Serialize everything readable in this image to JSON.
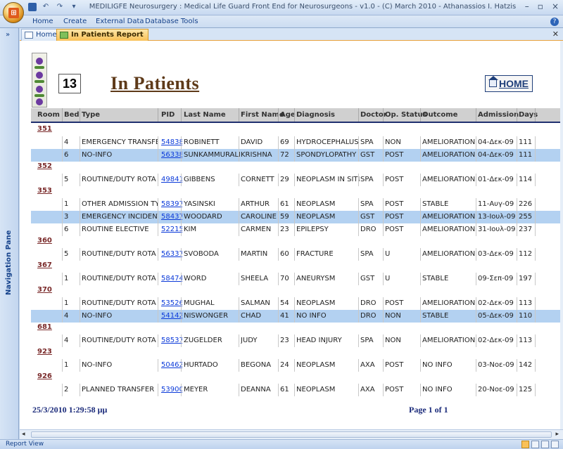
{
  "window": {
    "title": "MEDILIGFE Neurosurgery : Medical Life Guard Front End for Neurosurgeons - v1.0 - (C) March 2010 - Athanassios I. Hatzis",
    "controls": [
      "–",
      "▫",
      "×"
    ]
  },
  "ribbon": {
    "tabs": [
      "Home",
      "Create",
      "External Data",
      "Database Tools"
    ]
  },
  "nav_pane": {
    "label": "Navigation Pane",
    "toggle": "»"
  },
  "doc_tabs": [
    {
      "label": "Home",
      "active": false
    },
    {
      "label": "In Patients Report",
      "active": true
    }
  ],
  "report": {
    "count": "13",
    "title": "In Patients",
    "home_button": "HOME",
    "columns": [
      "Room",
      "Bed",
      "Type",
      "PID",
      "Last Name",
      "First Name",
      "Age",
      "Diagnosis",
      "Doctor",
      "Op. Status",
      "Outcome",
      "Admission",
      "Days"
    ],
    "groups": [
      {
        "room": "351",
        "rows": [
          {
            "bed": "4",
            "type": "EMERGENCY TRANSFER",
            "pid": "54838",
            "last": "ROBINETT",
            "first": "DAVID",
            "age": "69",
            "diagnosis": "HYDROCEPHALUS",
            "doctor": "SPA",
            "op": "NON",
            "outcome": "AMELIORATION",
            "admission": "04-Δεκ-09",
            "days": "111",
            "highlight": false
          },
          {
            "bed": "6",
            "type": "NO-INFO",
            "pid": "56338",
            "last": "SUNKAMMURALI",
            "first": "KRISHNA",
            "age": "72",
            "diagnosis": "SPONDYLOPATHY",
            "doctor": "GST",
            "op": "POST",
            "outcome": "AMELIORATION",
            "admission": "04-Δεκ-09",
            "days": "111",
            "highlight": true
          }
        ]
      },
      {
        "room": "352",
        "rows": [
          {
            "bed": "5",
            "type": "ROUTINE/DUTY ROTA",
            "pid": "49841",
            "last": "GIBBENS",
            "first": "CORNETT",
            "age": "29",
            "diagnosis": "NEOPLASM IN SITU",
            "doctor": "SPA",
            "op": "POST",
            "outcome": "AMELIORATION",
            "admission": "01-Δεκ-09",
            "days": "114",
            "highlight": false
          }
        ]
      },
      {
        "room": "353",
        "rows": [
          {
            "bed": "1",
            "type": "OTHER ADMISSION TYPE",
            "pid": "58397",
            "last": "YASINSKI",
            "first": "ARTHUR",
            "age": "61",
            "diagnosis": "NEOPLASM",
            "doctor": "SPA",
            "op": "POST",
            "outcome": "STABLE",
            "admission": "11-Αυγ-09",
            "days": "226",
            "highlight": false
          },
          {
            "bed": "3",
            "type": "EMERGENCY INCIDENT",
            "pid": "58437",
            "last": "WOODARD",
            "first": "CAROLINE",
            "age": "59",
            "diagnosis": "NEOPLASM",
            "doctor": "GST",
            "op": "POST",
            "outcome": "AMELIORATION",
            "admission": "13-Ιουλ-09",
            "days": "255",
            "highlight": true
          },
          {
            "bed": "6",
            "type": "ROUTINE ELECTIVE",
            "pid": "52215",
            "last": "KIM",
            "first": "CARMEN",
            "age": "23",
            "diagnosis": "EPILEPSY",
            "doctor": "DRO",
            "op": "POST",
            "outcome": "AMELIORATION",
            "admission": "31-Ιουλ-09",
            "days": "237",
            "highlight": false
          }
        ]
      },
      {
        "room": "360",
        "rows": [
          {
            "bed": "5",
            "type": "ROUTINE/DUTY ROTA",
            "pid": "56337",
            "last": "SVOBODA",
            "first": "MARTIN",
            "age": "60",
            "diagnosis": "FRACTURE",
            "doctor": "SPA",
            "op": "U",
            "outcome": "AMELIORATION",
            "admission": "03-Δεκ-09",
            "days": "112",
            "highlight": false
          }
        ]
      },
      {
        "room": "367",
        "rows": [
          {
            "bed": "1",
            "type": "ROUTINE/DUTY ROTA",
            "pid": "58474",
            "last": "WORD",
            "first": "SHEELA",
            "age": "70",
            "diagnosis": "ANEURYSM",
            "doctor": "GST",
            "op": "U",
            "outcome": "STABLE",
            "admission": "09-Σεπ-09",
            "days": "197",
            "highlight": false
          }
        ]
      },
      {
        "room": "370",
        "rows": [
          {
            "bed": "1",
            "type": "ROUTINE/DUTY ROTA",
            "pid": "53526",
            "last": "MUGHAL",
            "first": "SALMAN",
            "age": "54",
            "diagnosis": "NEOPLASM",
            "doctor": "DRO",
            "op": "POST",
            "outcome": "AMELIORATION",
            "admission": "02-Δεκ-09",
            "days": "113",
            "highlight": false
          },
          {
            "bed": "4",
            "type": "NO-INFO",
            "pid": "54142",
            "last": "NISWONGER",
            "first": "CHAD",
            "age": "41",
            "diagnosis": "NO INFO",
            "doctor": "DRO",
            "op": "NON",
            "outcome": "STABLE",
            "admission": "05-Δεκ-09",
            "days": "110",
            "highlight": true
          }
        ]
      },
      {
        "room": "681",
        "rows": [
          {
            "bed": "4",
            "type": "ROUTINE/DUTY ROTA",
            "pid": "58537",
            "last": "ZUGELDER",
            "first": "JUDY",
            "age": "23",
            "diagnosis": "HEAD INJURY",
            "doctor": "SPA",
            "op": "NON",
            "outcome": "AMELIORATION",
            "admission": "02-Δεκ-09",
            "days": "113",
            "highlight": false
          }
        ]
      },
      {
        "room": "923",
        "rows": [
          {
            "bed": "1",
            "type": "NO-INFO",
            "pid": "50462",
            "last": "HURTADO",
            "first": "BEGOÑA",
            "age": "24",
            "diagnosis": "NEOPLASM",
            "doctor": "AXA",
            "op": "POST",
            "outcome": "NO INFO",
            "admission": "03-Νοε-09",
            "days": "142",
            "highlight": false
          }
        ]
      },
      {
        "room": "926",
        "rows": [
          {
            "bed": "2",
            "type": "PLANNED TRANSFER",
            "pid": "53900",
            "last": "MEYER",
            "first": "DEANNA",
            "age": "61",
            "diagnosis": "NEOPLASM",
            "doctor": "AXA",
            "op": "POST",
            "outcome": "NO INFO",
            "admission": "20-Νοε-09",
            "days": "125",
            "highlight": false
          }
        ]
      }
    ],
    "footer_date": "25/3/2010 1:29:58 μμ",
    "footer_page": "Page 1 of 1"
  },
  "status": {
    "text": "Report View"
  },
  "colors": {
    "highlight_row": "#b3d1f1",
    "header_bg": "#d0d0d0",
    "title": "#5e3a19",
    "link": "#0b3ad9",
    "active_tab": "#f9c158"
  }
}
